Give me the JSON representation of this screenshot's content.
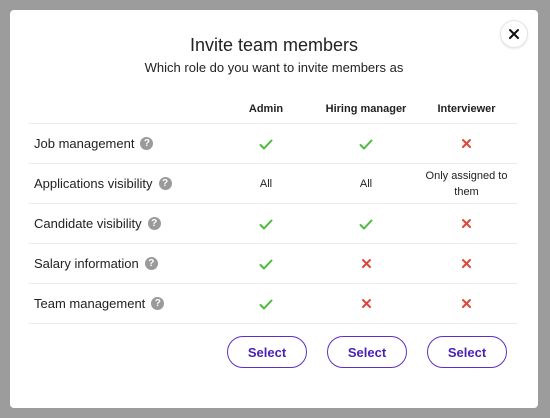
{
  "dialog": {
    "title": "Invite team members",
    "subtitle": "Which role do you want to invite members as",
    "close_icon": "close-icon"
  },
  "table": {
    "columns": [
      "Admin",
      "Hiring manager",
      "Interviewer"
    ],
    "help_glyph": "?",
    "rows": [
      {
        "feature": "Job management",
        "values": [
          "check",
          "check",
          "cross"
        ]
      },
      {
        "feature": "Applications visibility",
        "values": [
          "All",
          "All",
          "Only assigned to them"
        ]
      },
      {
        "feature": "Candidate visibility",
        "values": [
          "check",
          "check",
          "cross"
        ]
      },
      {
        "feature": "Salary information",
        "values": [
          "check",
          "cross",
          "cross"
        ]
      },
      {
        "feature": "Team management",
        "values": [
          "check",
          "cross",
          "cross"
        ]
      }
    ]
  },
  "actions": {
    "select_label": "Select"
  },
  "colors": {
    "check": "#4cbb3c",
    "cross": "#e0453a",
    "accent": "#5b2fc9",
    "backdrop": "#9c9c9c"
  }
}
